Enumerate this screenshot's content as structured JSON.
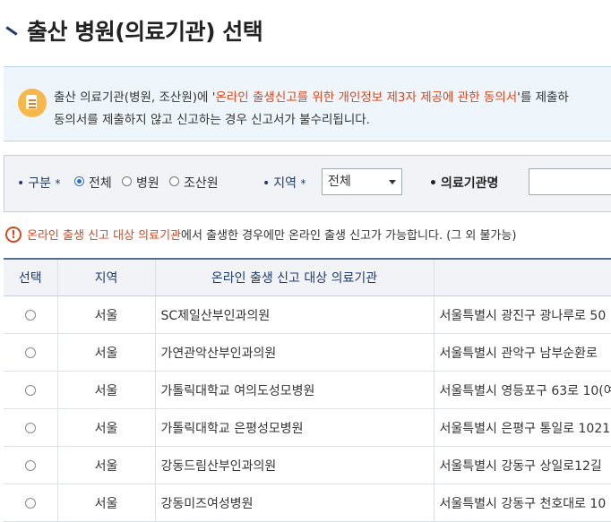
{
  "page": {
    "title": "출산 병원(의료기관) 선택"
  },
  "notice": {
    "line1_pre": "출산 의료기관(병원, 조산원)에 '",
    "line1_highlight": "온라인 출생신고를 위한 개인정보 제3자 제공에 관한 동의서",
    "line1_post": "'를 제출하",
    "line2": "동의서를 제출하지 않고 신고하는 경우 신고서가 불수리됩니다."
  },
  "filter": {
    "type_label": "구분",
    "type_options": [
      {
        "label": "전체",
        "selected": true
      },
      {
        "label": "병원",
        "selected": false
      },
      {
        "label": "조산원",
        "selected": false
      }
    ],
    "region_label": "지역",
    "region_selected": "전체",
    "name_label": "의료기관명",
    "name_value": ""
  },
  "alert": {
    "highlight": "온라인 출생 신고 대상 의료기관",
    "text": "에서 출생한 경우에만 온라인 출생 신고가 가능합니다. (그 외 불가능)"
  },
  "table": {
    "headers": [
      "선택",
      "지역",
      "온라인 출생 신고 대상 의료기관",
      ""
    ],
    "rows": [
      {
        "region": "서울",
        "name": "SC제일산부인과의원",
        "address": "서울특별시 광진구 광나루로 50"
      },
      {
        "region": "서울",
        "name": "가연관악산부인과의원",
        "address": "서울특별시 관악구 남부순환로"
      },
      {
        "region": "서울",
        "name": "가톨릭대학교 여의도성모병원",
        "address": "서울특별시 영등포구 63로 10(여"
      },
      {
        "region": "서울",
        "name": "가톨릭대학교 은평성모병원",
        "address": "서울특별시 은평구 통일로 1021"
      },
      {
        "region": "서울",
        "name": "강동드림산부인과의원",
        "address": "서울특별시 강동구 상일로12길"
      },
      {
        "region": "서울",
        "name": "강동미즈여성병원",
        "address": "서울특별시 강동구 천호대로 10"
      }
    ]
  },
  "colors": {
    "accent": "#1e3b6e",
    "highlight": "#d9461e",
    "selected_radio": "#2d6fd2"
  }
}
